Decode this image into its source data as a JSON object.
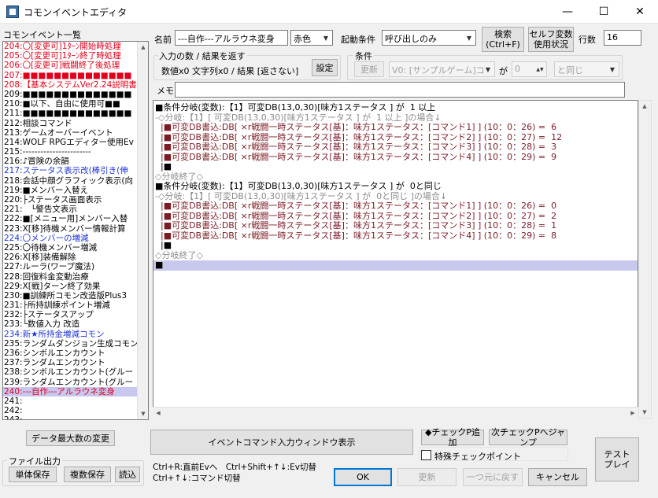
{
  "window": {
    "title": "コモンイベントエディタ",
    "controls": [
      "—",
      "☐",
      "✕"
    ]
  },
  "list": {
    "label": "コモンイベント一覧",
    "items": [
      {
        "text": "204:〇[変更可]1ﾀｰﾝ開始時処理",
        "color": "red"
      },
      {
        "text": "205:〇[変更可]1ﾀｰﾝ終了時処理",
        "color": "red"
      },
      {
        "text": "206:〇[変更可]戦闘終了後処理",
        "color": "red"
      },
      {
        "text": "207:■■■■■■■■■■■■■■",
        "color": "red"
      },
      {
        "text": "208:【基本システムVer2.24説明書】",
        "color": "red"
      },
      {
        "text": "209:■■■■■■■■■■■■■■",
        "color": "black"
      },
      {
        "text": "210:■以下、自由に使用可■■",
        "color": "black"
      },
      {
        "text": "211:■■■■■■■■■■■■■■",
        "color": "black"
      },
      {
        "text": "212:相談コマンド",
        "color": "black"
      },
      {
        "text": "213:ゲームオーバーイベント",
        "color": "black"
      },
      {
        "text": "214:WOLF RPGエディター使用Ev",
        "color": "black"
      },
      {
        "text": "215:-----------------------",
        "color": "black"
      },
      {
        "text": "216:♪冒険の余韻",
        "color": "black"
      },
      {
        "text": "217:ステータス表示改(棒引き(伸",
        "color": "blue"
      },
      {
        "text": "218:会話中顔グラフィック表示(向",
        "color": "black"
      },
      {
        "text": "219:■メンバー入替え",
        "color": "black"
      },
      {
        "text": "220:├ステータス画面表示",
        "color": "black"
      },
      {
        "text": "221:　└警告文表示",
        "color": "black"
      },
      {
        "text": "222:■[メニュー用]メンバー入替",
        "color": "black"
      },
      {
        "text": "223:X[移]待機メンバー情報計算",
        "color": "black"
      },
      {
        "text": "224:〇メンバーの増減",
        "color": "blue"
      },
      {
        "text": "225:〇待機メンバー増減",
        "color": "black"
      },
      {
        "text": "226:X[移]装備解除",
        "color": "black"
      },
      {
        "text": "227:ルーラ(ワープ魔法)",
        "color": "black"
      },
      {
        "text": "228:回復料金変動治療",
        "color": "black"
      },
      {
        "text": "229:X[戦]ターン終了効果",
        "color": "black"
      },
      {
        "text": "230:■訓練所コモン改造版Plus3",
        "color": "black"
      },
      {
        "text": "231:├所持訓練ポイント増減",
        "color": "black"
      },
      {
        "text": "232:├ステータスアップ",
        "color": "black"
      },
      {
        "text": "233:└数値入力 改造",
        "color": "black"
      },
      {
        "text": "234:新★所持金増減コモン",
        "color": "blue"
      },
      {
        "text": "235:ランダムダンジョン生成コモン",
        "color": "black"
      },
      {
        "text": "236:シンボルエンカウント",
        "color": "black"
      },
      {
        "text": "237:ランダムエンカウント",
        "color": "black"
      },
      {
        "text": "238:シンボルエンカウント(グルー",
        "color": "black"
      },
      {
        "text": "239:ランダムエンカウント(グルー",
        "color": "black"
      },
      {
        "text": "240:---自作---アルラウネ変身",
        "color": "sel"
      },
      {
        "text": "241:",
        "color": "black"
      },
      {
        "text": "242:",
        "color": "black"
      },
      {
        "text": "243:",
        "color": "black"
      }
    ]
  },
  "header": {
    "name_label": "名前",
    "name_value": "---自作---アルラウネ変身",
    "color_value": "赤色",
    "trigger_label": "起動条件",
    "trigger_value": "呼び出しのみ",
    "search_button": "検索\n(Ctrl+F)",
    "selfvar_button": "セルフ変数\n使用状況",
    "lines_label": "行数",
    "lines_value": "16"
  },
  "io_group": {
    "title": "入力の数 / 結果を返す",
    "summary": "数値x0 文字列x0 / 結果 [返さない]",
    "settings_button": "設定"
  },
  "cond_group": {
    "title": "条件",
    "update_button": "更新",
    "var_value": "V0: [サンプルゲーム]コ",
    "ga_label": "が",
    "num_value": "0",
    "op_value": "と同じ"
  },
  "memo": {
    "label": "メモ",
    "value": ""
  },
  "script": {
    "lines": [
      {
        "style": "black",
        "text": "■条件分岐(変数):【1】可変DB(13,0,30)[味方1ステータス ] が  1 以上"
      },
      {
        "style": "gray",
        "text": "-◇分岐:【1】[ 可変DB(13,0,30)[味方1ステータス ] が  1 以上 ]の場合↓"
      },
      {
        "style": "dark",
        "text": "  |■可変DB書込:DB[ ×r戦闘一時ステータス[基]：味方1ステータス：[コマンド1] ] (10：0：26) =  6"
      },
      {
        "style": "dark",
        "text": "  |■可変DB書込:DB[ ×r戦闘一時ステータス[基]：味方1ステータス：[コマンド2] ] (10：0：27) =  12"
      },
      {
        "style": "dark",
        "text": "  |■可変DB書込:DB[ ×r戦闘一時ステータス[基]：味方1ステータス：[コマンド3] ] (10：0：28) =  3"
      },
      {
        "style": "dark",
        "text": "  |■可変DB書込:DB[ ×r戦闘一時ステータス[基]：味方1ステータス：[コマンド4] ] (10：0：29) =  9"
      },
      {
        "style": "black",
        "text": "  |■"
      },
      {
        "style": "gray",
        "text": "◇分岐終了◇"
      },
      {
        "style": "black",
        "text": "■条件分岐(変数):【1】可変DB(13,0,30)[味方1ステータス ] が  0と同じ"
      },
      {
        "style": "gray",
        "text": "-◇分岐:【1】[ 可変DB(13,0,30)[味方1ステータス ] が  0と同じ ]の場合↓"
      },
      {
        "style": "dark",
        "text": "  |■可変DB書込:DB[ ×r戦闘一時ステータス[基]：味方1ステータス：[コマンド1] ] (10：0：26) =  0"
      },
      {
        "style": "dark",
        "text": "  |■可変DB書込:DB[ ×r戦闘一時ステータス[基]：味方1ステータス：[コマンド2] ] (10：0：27) =  2"
      },
      {
        "style": "dark",
        "text": "  |■可変DB書込:DB[ ×r戦闘一時ステータス[基]：味方1ステータス：[コマンド3] ] (10：0：28) =  1"
      },
      {
        "style": "dark",
        "text": "  |■可変DB書込:DB[ ×r戦闘一時ステータス[基]：味方1ステータス：[コマンド4] ] (10：0：29) =  8"
      },
      {
        "style": "black",
        "text": "  |■"
      },
      {
        "style": "gray",
        "text": "◇分岐終了◇"
      },
      {
        "style": "cur",
        "text": "■"
      }
    ]
  },
  "bottom": {
    "data_max_button": "データ最大数の変更",
    "file_group_title": "ファイル出力",
    "save_single": "単体保存",
    "save_multi": "複数保存",
    "load": "読込",
    "input_window_button": "イベントコマンド入力ウィンドウ表示",
    "add_checkpoint": "◆チェックP追加",
    "next_checkpoint": "次チェックPへジャンプ",
    "special_checkpoint": "特殊チェックポイント",
    "test_play": "テスト\nプレイ",
    "hint1": "Ctrl+R:直前Evへ　Ctrl+Shift+↑↓:Ev切替",
    "hint2": "Ctrl+↑↓:コマンド切替",
    "ok": "OK",
    "update": "更新",
    "undo": "一つ元に戻す",
    "cancel": "キャンセル"
  }
}
